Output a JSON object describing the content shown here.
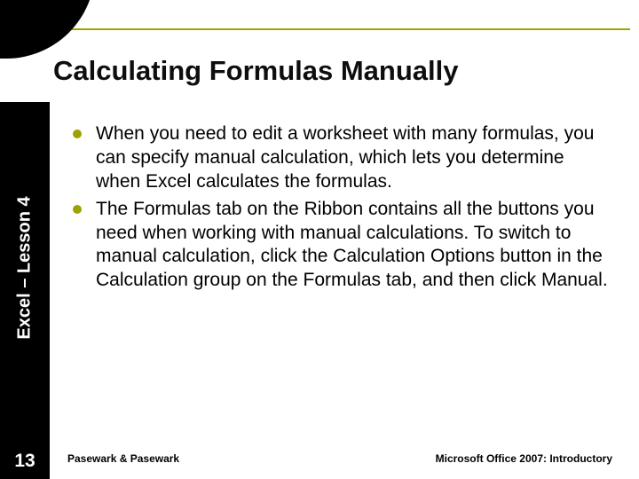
{
  "sidebar": {
    "label": "Excel – Lesson 4",
    "page_number": "13"
  },
  "title": "Calculating Formulas Manually",
  "bullets": [
    "When you need to edit a worksheet with many formulas, you can specify manual calculation, which lets you determine when Excel calculates the formulas.",
    "The Formulas tab on the Ribbon contains all the buttons you need when working with manual calculations. To switch to manual calculation, click the Calculation Options button in the Calculation group on the Formulas tab, and then click Manual."
  ],
  "footer": {
    "left": "Pasewark & Pasewark",
    "right": "Microsoft Office 2007:  Introductory"
  }
}
